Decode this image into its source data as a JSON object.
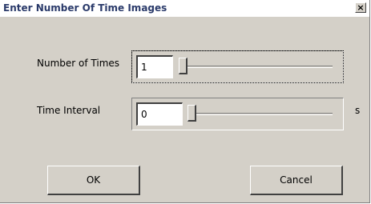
{
  "window": {
    "title": "Enter Number Of Time Images",
    "close_glyph": "×"
  },
  "number_of_times": {
    "label": "Number of Times",
    "value": "1",
    "slider_position": 0.0
  },
  "time_interval": {
    "label": "Time Interval",
    "value": "0",
    "unit": "s",
    "slider_position": 0.0
  },
  "buttons": {
    "ok": "OK",
    "cancel": "Cancel"
  },
  "icons": [
    "close-icon",
    "slider-thumb"
  ]
}
